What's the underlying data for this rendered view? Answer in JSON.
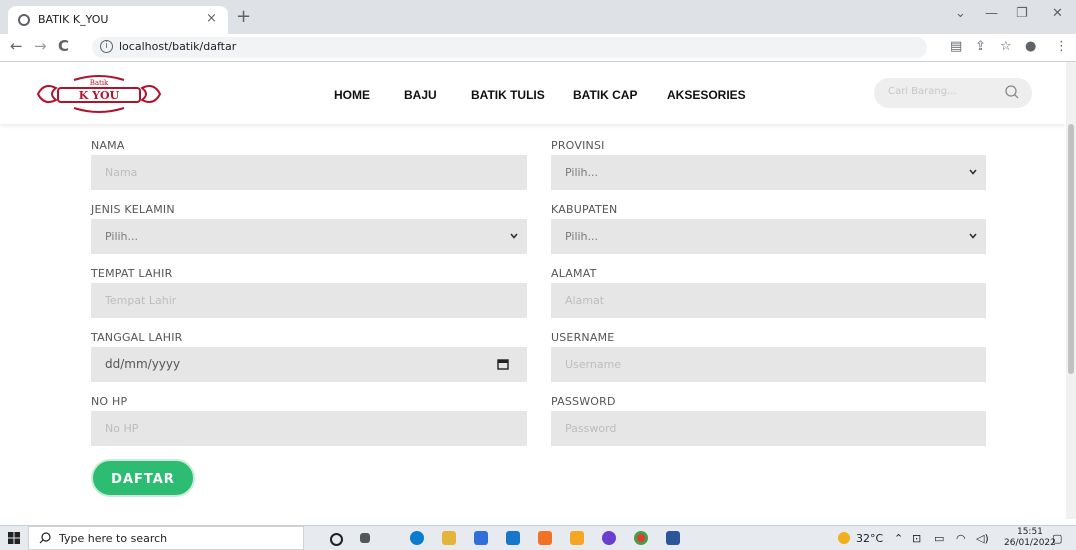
{
  "browser": {
    "tab_title": "BATIK K_YOU",
    "tab_close": "×",
    "new_tab": "+",
    "url": "localhost/batik/daftar",
    "win_min": "—",
    "win_max": "❐",
    "win_close": "✕",
    "back": "←",
    "forward": "→",
    "reload": "C"
  },
  "site": {
    "logo_top": "Batik",
    "logo_main": "K YOU",
    "nav": [
      "HOME",
      "BAJU",
      "BATIK TULIS",
      "BATIK CAP",
      "AKSESORIES"
    ],
    "search_placeholder": "Cari Barang..."
  },
  "form": {
    "nama_label": "NAMA",
    "nama_placeholder": "Nama",
    "jk_label": "JENIS KELAMIN",
    "jk_value": "Pilih...",
    "tempat_label": "TEMPAT LAHIR",
    "tempat_placeholder": "Tempat Lahir",
    "tanggal_label": "TANGGAL LAHIR",
    "tanggal_value": "dd/mm/yyyy",
    "hp_label": "NO HP",
    "hp_placeholder": "No HP",
    "provinsi_label": "PROVINSI",
    "provinsi_value": "Pilih...",
    "kabupaten_label": "KABUPATEN",
    "kabupaten_value": "Pilih...",
    "alamat_label": "ALAMAT",
    "alamat_placeholder": "Alamat",
    "username_label": "USERNAME",
    "username_placeholder": "Username",
    "password_label": "PASSWORD",
    "password_placeholder": "Password",
    "submit": "DAFTAR"
  },
  "taskbar": {
    "search_text": "Type here to search",
    "temperature": "32°C",
    "time": "15:51",
    "date": "26/01/2022"
  },
  "colors": {
    "accent": "#2dbd72",
    "field_bg": "#e6e6e6",
    "logo_red": "#b0142c"
  }
}
